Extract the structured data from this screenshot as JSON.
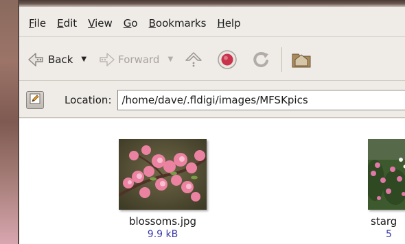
{
  "menubar": {
    "items": [
      {
        "mnemonic": "F",
        "rest": "ile"
      },
      {
        "mnemonic": "E",
        "rest": "dit"
      },
      {
        "mnemonic": "V",
        "rest": "iew"
      },
      {
        "mnemonic": "G",
        "rest": "o"
      },
      {
        "mnemonic": "B",
        "rest": "ookmarks"
      },
      {
        "mnemonic": "H",
        "rest": "elp"
      }
    ]
  },
  "toolbar": {
    "back_label": "Back",
    "forward_label": "Forward",
    "icons": [
      "back-arrow-icon",
      "forward-arrow-icon",
      "up-icon",
      "stop-icon",
      "reload-icon",
      "home-folder-icon"
    ]
  },
  "location": {
    "label": "Location:",
    "path": "/home/dave/.fldigi/images/MFSKpics"
  },
  "files": [
    {
      "name": "blossoms.jpg",
      "size": "9.9 kB"
    },
    {
      "name": "starg",
      "size": "5"
    }
  ],
  "colors": {
    "window_bg": "#efebe7",
    "file_size_text": "#3c3ca8",
    "stop_red": "#c8324a"
  }
}
